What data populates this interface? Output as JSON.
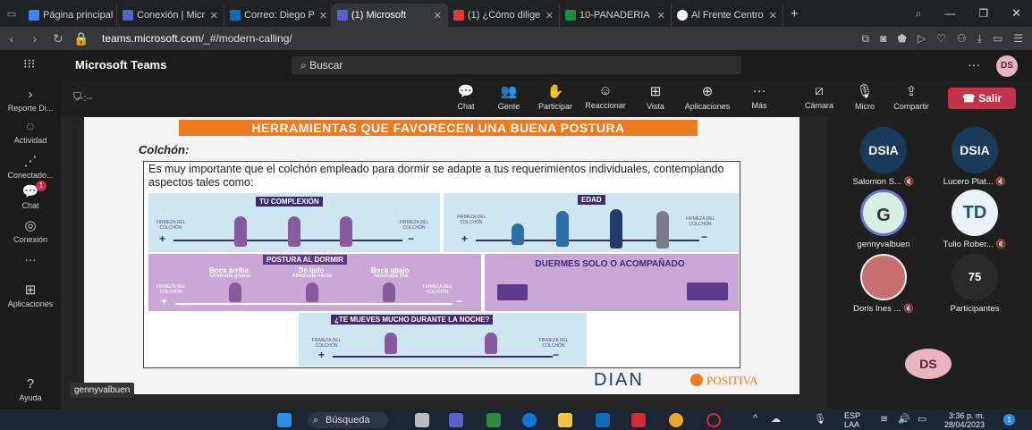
{
  "browser": {
    "tabs": [
      {
        "label": "Página principal",
        "color": "#3b82f6"
      },
      {
        "label": "Conexión | Micr",
        "color": "#5b5fc7"
      },
      {
        "label": "Correo: Diego P",
        "color": "#0f6cbd"
      },
      {
        "label": "(1) Microsoft",
        "color": "#5b5fc7",
        "active": true
      },
      {
        "label": "(1) ¿Cómo dilige",
        "color": "#e53935"
      },
      {
        "label": "10-PANADERIA",
        "color": "#1e8e3e"
      },
      {
        "label": "Al Frente Centro",
        "color": "#ffffff"
      }
    ],
    "url_host": "teams.microsoft.com",
    "url_path": "/_#/modern-calling/"
  },
  "teams": {
    "app_name": "Microsoft Teams",
    "search_placeholder": "Buscar",
    "more": "···",
    "user_initials": "DS",
    "timer": "--:--",
    "rail": [
      {
        "label": "Reporte Di...",
        "icon": "chevron-right-icon"
      },
      {
        "label": "Actividad",
        "icon": "bell-icon"
      },
      {
        "label": "Conectado...",
        "icon": "dots-icon"
      },
      {
        "label": "Chat",
        "icon": "chat-icon",
        "badge": "1"
      },
      {
        "label": "Conexión",
        "icon": "compass-icon"
      },
      {
        "label": "···",
        "icon": "more-icon"
      },
      {
        "label": "Aplicaciones",
        "icon": "apps-icon"
      },
      {
        "label": "Ayuda",
        "icon": "help-icon"
      }
    ],
    "toolbar": [
      {
        "label": "Chat",
        "icon": "chat-icon"
      },
      {
        "label": "Gente",
        "icon": "people-icon"
      },
      {
        "label": "Participar",
        "icon": "hand-icon"
      },
      {
        "label": "Reaccionar",
        "icon": "smile-icon"
      },
      {
        "label": "Vista",
        "icon": "grid-icon"
      },
      {
        "label": "Aplicaciones",
        "icon": "plus-icon"
      },
      {
        "label": "Más",
        "icon": "more-icon"
      },
      {
        "label": "Cámara",
        "icon": "camera-off-icon"
      },
      {
        "label": "Micro",
        "icon": "mic-off-icon"
      },
      {
        "label": "Compartir",
        "icon": "share-icon"
      }
    ],
    "leave_label": "Salir",
    "presenter_name": "gennyvalbuen"
  },
  "slide": {
    "banner": "HERRAMIENTAS QUE FAVORECEN UNA BUENA POSTURA",
    "subtitle": "Colchón:",
    "description": "Es muy importante que el colchón empleado para dormir se adapte a tus requerimientos individuales, contemplando aspectos tales como:",
    "panels": {
      "complexion": "TU COMPLEXIÓN",
      "edad": "EDAD",
      "postura": "POSTURA AL DORMIR",
      "solo": "DUERMES SOLO O ACOMPAÑADO",
      "noche": "¿TE MUEVES MUCHO DURANTE LA NOCHE?"
    },
    "firmeza": "FIRMEZA DEL COLCHÓN",
    "postures": [
      {
        "title": "Boca arriba",
        "sub": "Almohada gruesa"
      },
      {
        "title": "De lado",
        "sub": "Almohada media"
      },
      {
        "title": "Boca abajo",
        "sub": "Almohada fina"
      }
    ],
    "logo_dian": "DIAN",
    "logo_positiva": "POSITIVA"
  },
  "participants": [
    {
      "initials": "DSIA",
      "name": "Salomon S...",
      "color": "#1a3a5c"
    },
    {
      "initials": "DSIA",
      "name": "Lucero Plat...",
      "color": "#1a3a5c"
    },
    {
      "initials": "G",
      "name": "gennyvalbuen",
      "color": "#d9ede3"
    },
    {
      "initials": "TD",
      "name": "Tulio Rober...",
      "color": "#e8f4f8"
    },
    {
      "initials": "",
      "name": "Doris Ines ...",
      "color": "#c96e6e"
    },
    {
      "initials": "75",
      "name": "Participantes",
      "color": "#2a2a2a"
    }
  ],
  "self_initials": "DS",
  "taskbar": {
    "search": "Búsqueda",
    "lang": "ESP",
    "lang2": "LAA",
    "time": "3:36 p. m.",
    "date": "28/04/2023",
    "notif": "1"
  }
}
